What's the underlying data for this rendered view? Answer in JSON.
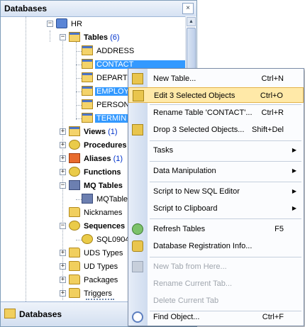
{
  "panel": {
    "title": "Databases",
    "close_glyph": "×",
    "footer_label": "Databases"
  },
  "tree": {
    "hr": "HR",
    "tables": {
      "label": "Tables",
      "count": "(6)"
    },
    "table_items": [
      "ADDRESS",
      "CONTACT",
      "DEPART",
      "EMPLOY",
      "PERSON",
      "TERMIN"
    ],
    "views": {
      "label": "Views",
      "count": "(1)"
    },
    "procedures": "Procedures",
    "aliases": {
      "label": "Aliases",
      "count": "(1)"
    },
    "functions": "Functions",
    "mq_tables": "MQ Tables",
    "mq_table_item": "MQTable",
    "nicknames": "Nicknames",
    "sequences": "Sequences",
    "sequence_item": "SQL0904",
    "uds_types": "UDS Types",
    "ud_types": "UD Types",
    "packages": "Packages",
    "triggers": "Triggers"
  },
  "menu": {
    "new_table": {
      "label": "New Table...",
      "shortcut": "Ctrl+N"
    },
    "edit_selected": {
      "label": "Edit 3 Selected Objects",
      "shortcut": "Ctrl+O"
    },
    "rename_table": {
      "label": "Rename Table 'CONTACT'...",
      "shortcut": "Ctrl+R"
    },
    "drop_selected": {
      "label": "Drop 3 Selected Objects...",
      "shortcut": "Shift+Del"
    },
    "tasks": {
      "label": "Tasks"
    },
    "data_manipulation": {
      "label": "Data Manipulation"
    },
    "script_sql_editor": {
      "label": "Script to New SQL Editor"
    },
    "script_clipboard": {
      "label": "Script to Clipboard"
    },
    "refresh_tables": {
      "label": "Refresh Tables",
      "shortcut": "F5"
    },
    "db_registration": {
      "label": "Database Registration Info..."
    },
    "new_tab": {
      "label": "New Tab from Here..."
    },
    "rename_tab": {
      "label": "Rename Current Tab..."
    },
    "delete_tab": {
      "label": "Delete Current Tab"
    },
    "find_object": {
      "label": "Find Object...",
      "shortcut": "Ctrl+F"
    }
  },
  "colors": {
    "selection": "#3399ff",
    "menu_highlight": "#ffe9a8",
    "count": "#0033cc"
  }
}
